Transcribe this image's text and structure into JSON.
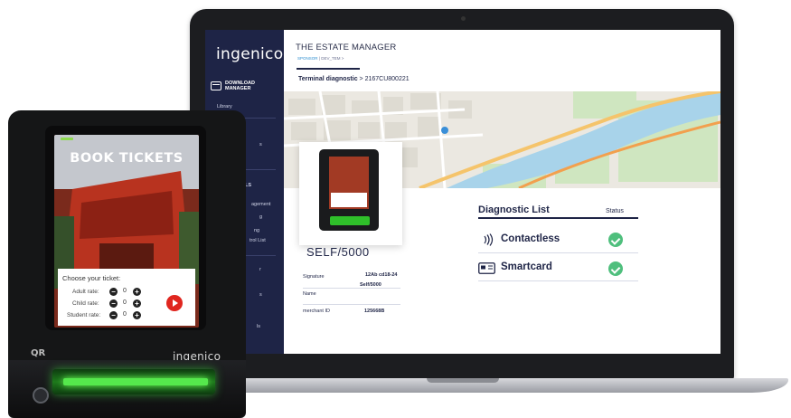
{
  "app": {
    "sidebar": {
      "logo": "ingenico",
      "download_manager": "DOWNLOAD\nMANAGER",
      "items": [
        "Library",
        "s",
        "LS",
        "agement",
        "g",
        "ng",
        "trol List",
        "r",
        "s",
        "ls"
      ]
    },
    "header": {
      "title": "THE ESTATE MANAGER",
      "crumb_link": "SPONSOR",
      "crumb_rest": "DEV_TEM >",
      "page_prefix": "Terminal diagnostic",
      "page_suffix": " > 2167CU800221"
    },
    "terminal": {
      "name": "SELF/5000",
      "signature_label": "Signature",
      "signature_value": "12Ab cd18-24",
      "name_label": "Name",
      "name_value": "Self/5000",
      "merchant_label": "merchant ID",
      "merchant_value": "125668B"
    },
    "diagnostic": {
      "title": "Diagnostic List",
      "status_header": "Status",
      "items": [
        {
          "label": "Contactless",
          "status": "ok",
          "icon": "contactless-icon"
        },
        {
          "label": "Smartcard",
          "status": "ok",
          "icon": "smartcard-icon"
        }
      ],
      "status_color": "#4fbf7d"
    }
  },
  "device": {
    "screen_title": "BOOK TICKETS",
    "choose_prompt": "Choose your ticket:",
    "rates": [
      {
        "label": "Adult rate:",
        "count": "0"
      },
      {
        "label": "Child rate:",
        "count": "0"
      },
      {
        "label": "Student rate:",
        "count": "0"
      }
    ],
    "brand": "ingenico",
    "qr_label": "QR",
    "slot_glow_color": "#55e84c"
  },
  "colors": {
    "sidebar": "#1e2446",
    "accent": "#2f8fd0"
  }
}
